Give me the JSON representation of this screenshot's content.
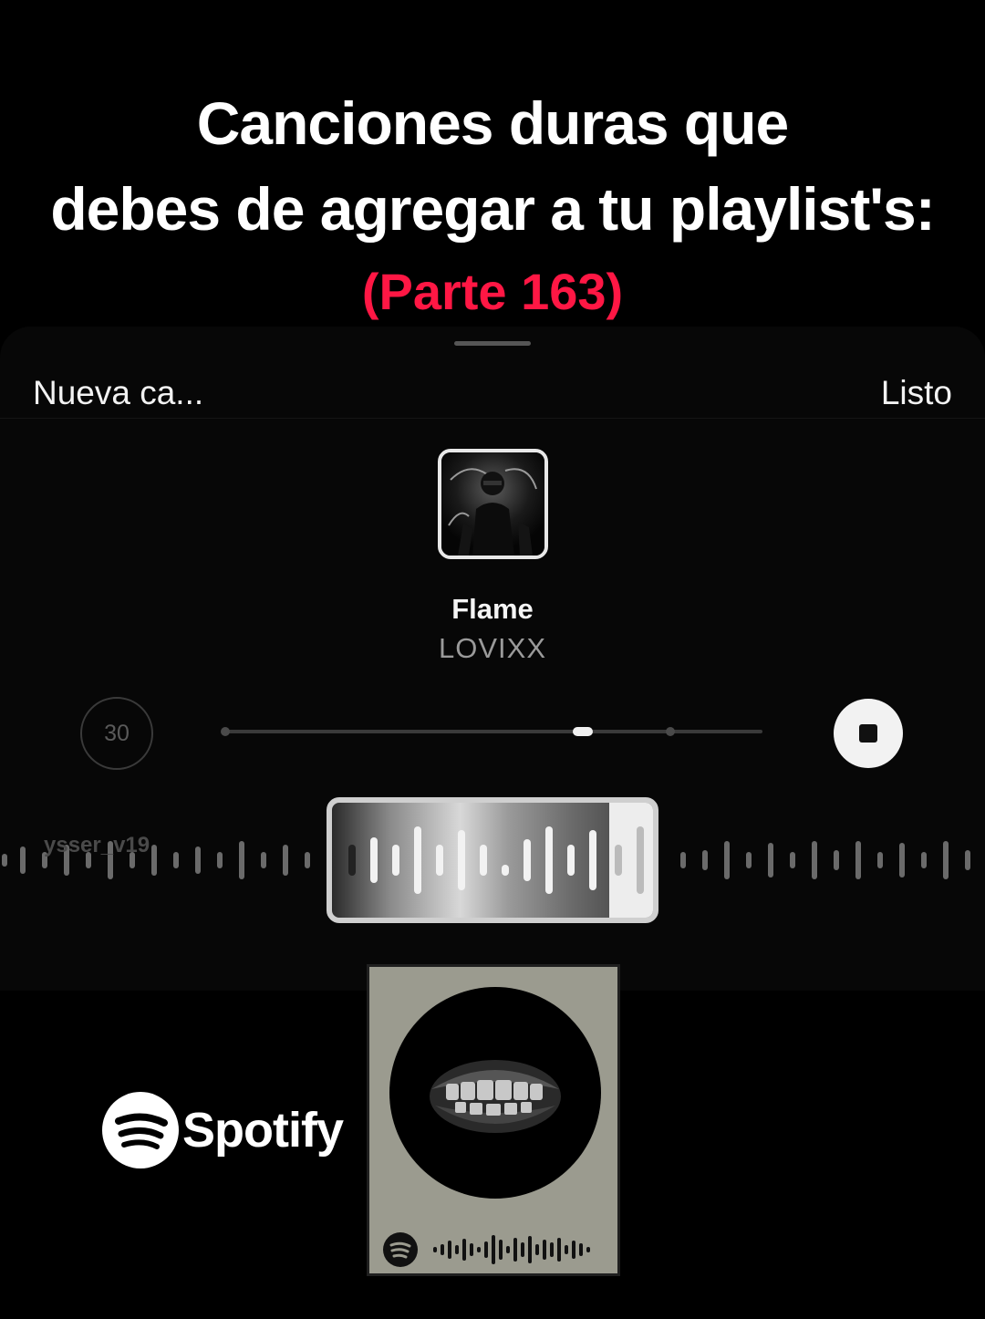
{
  "headline": {
    "line1": "Canciones duras que",
    "line2": "debes de agregar a tu playlist's:",
    "part": "(Parte 163)"
  },
  "sheet": {
    "left_label": "Nueva ca...",
    "right_label": "Listo"
  },
  "track": {
    "title": "Flame",
    "artist": "LOVIXX",
    "duration_seconds": "30"
  },
  "waveform": {
    "watermark": "ysser_v19"
  },
  "logo": {
    "wordmark": "Spotify"
  },
  "colors": {
    "background": "#000000",
    "accent_red": "#ff1744",
    "card": "#9b9b8f"
  },
  "icons": [
    "stop-icon",
    "spotify-icon",
    "spotify-code-icon"
  ]
}
